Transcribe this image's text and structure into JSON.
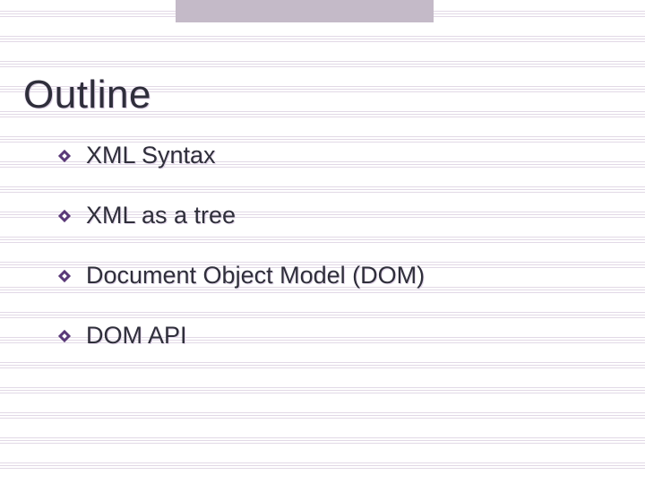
{
  "slide": {
    "title": "Outline",
    "bullets": [
      {
        "text": "XML Syntax"
      },
      {
        "text": "XML as a tree"
      },
      {
        "text": "Document Object Model (DOM)"
      },
      {
        "text": "DOM API"
      }
    ]
  },
  "colors": {
    "accent_bullet": "#5a3a78",
    "topbar": "#c4bac8",
    "rule_line": "#e2d9e6"
  }
}
